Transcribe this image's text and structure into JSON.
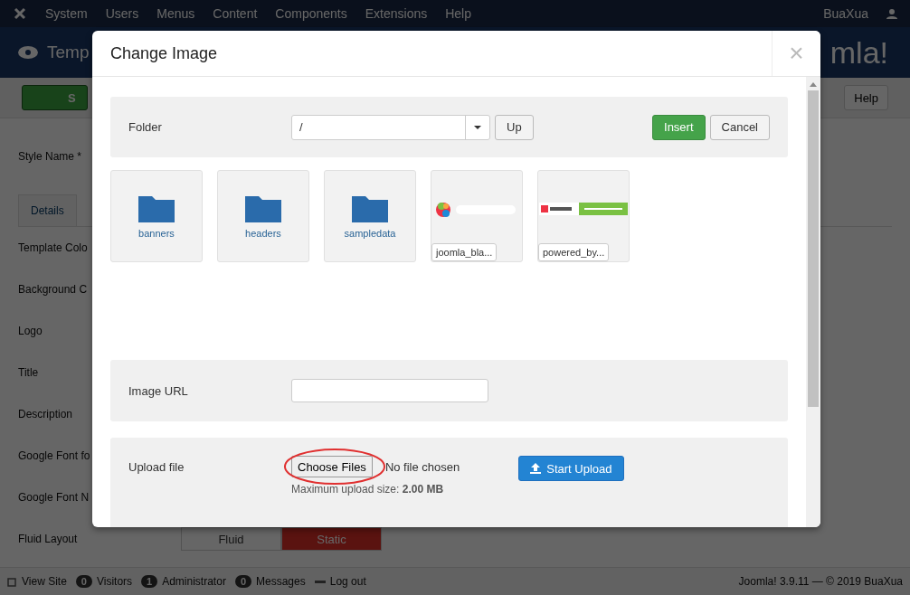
{
  "navbar": {
    "menu": [
      "System",
      "Users",
      "Menus",
      "Content",
      "Components",
      "Extensions",
      "Help"
    ],
    "user": "BuaXua"
  },
  "header": {
    "title": "Temp",
    "logo_text": "mla!"
  },
  "toolbar": {
    "save_label": "S",
    "help_label": "Help"
  },
  "form": {
    "style_name_label": "Style Name *",
    "tabs": [
      {
        "label": "Details"
      }
    ],
    "fields": [
      "Template Colo",
      "Background C",
      "Logo",
      "Title",
      "Description",
      "Google Font fo",
      "Google Font N",
      "Fluid Layout"
    ],
    "layout_options": [
      {
        "label": "Fluid",
        "selected": false
      },
      {
        "label": "Static",
        "selected": true
      }
    ]
  },
  "modal": {
    "title": "Change Image",
    "close": "×",
    "folder": {
      "label": "Folder",
      "value": "/",
      "up": "Up",
      "insert": "Insert",
      "cancel": "Cancel"
    },
    "items": [
      {
        "kind": "folder",
        "name": "banners"
      },
      {
        "kind": "folder",
        "name": "headers"
      },
      {
        "kind": "folder",
        "name": "sampledata"
      },
      {
        "name": "joomla_bla..."
      },
      {
        "name": "powered_by..."
      }
    ],
    "image_url": {
      "label": "Image URL"
    },
    "upload": {
      "label": "Upload file",
      "choose": "Choose Files",
      "no_file": "No file chosen",
      "max_size": "Maximum upload size: **2.00 MB**",
      "start": "Start Upload"
    }
  },
  "status_bar": {
    "items": [
      {
        "kind": "link",
        "label": "View Site"
      },
      {
        "kind": "count",
        "count": "0",
        "label": "Visitors"
      },
      {
        "kind": "count",
        "count": "1",
        "label": "Administrator"
      },
      {
        "kind": "count",
        "count": "0",
        "label": "Messages"
      },
      {
        "kind": "logout",
        "label": "Log out"
      }
    ],
    "copyright": "Joomla! 3.9.11 — © 2019 BuaXua"
  }
}
